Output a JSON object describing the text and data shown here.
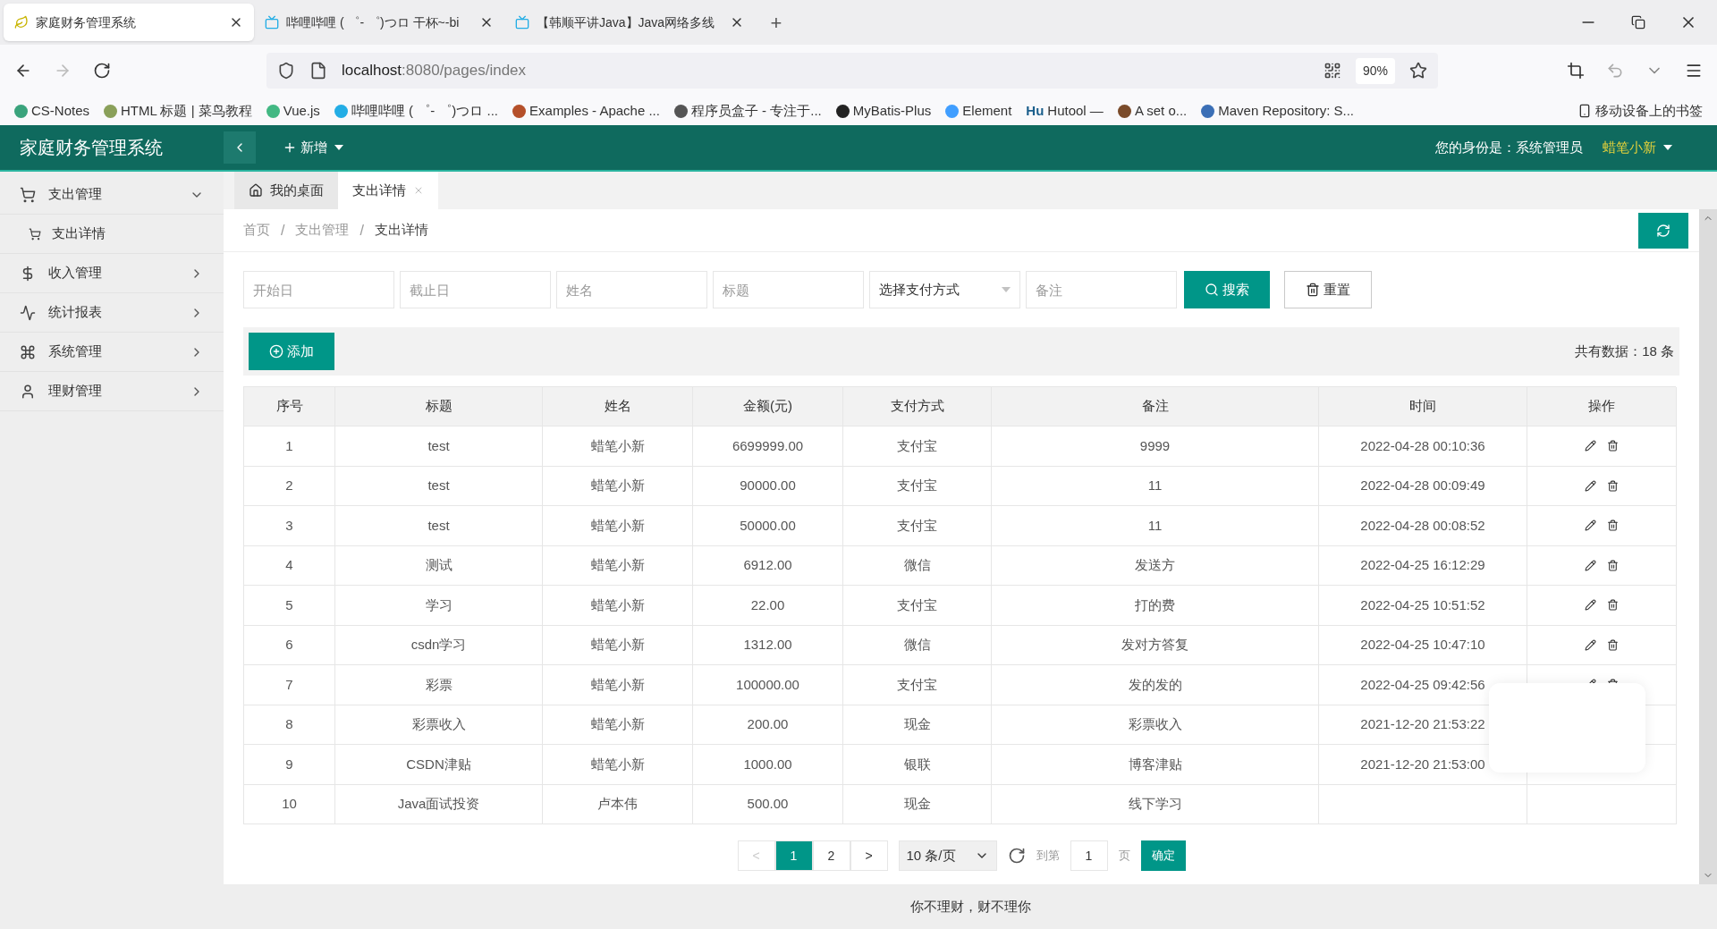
{
  "browser": {
    "tabs": [
      {
        "title": "家庭财务管理系统",
        "selected": true
      },
      {
        "title": "哔哩哔哩 ( ゜- ゜)つロ 干杯~-bi",
        "selected": false
      },
      {
        "title": "【韩顺平讲Java】Java网络多线",
        "selected": false
      }
    ],
    "new_tab": "+",
    "address": {
      "host": "localhost",
      "path": ":8080/pages/index"
    },
    "zoom": "90%",
    "bookmarks": [
      {
        "label": "CS-Notes",
        "color": "#3aa37c"
      },
      {
        "label": "HTML 标题 | 菜鸟教程",
        "color": "#8aa05a"
      },
      {
        "label": "Vue.js",
        "color": "#42b883"
      },
      {
        "label": "哔哩哔哩 ( ゜- ゜)つロ ...",
        "color": "#23ade5"
      },
      {
        "label": "Examples - Apache ...",
        "color": "#b5502a"
      },
      {
        "label": "程序员盒子 - 专注于...",
        "color": "#555555"
      },
      {
        "label": "MyBatis-Plus",
        "color": "#222222"
      },
      {
        "label": "Element",
        "color": "#409eff"
      },
      {
        "label": "Hutool —",
        "color": "#1b5f8c",
        "icon_text": "Hu"
      },
      {
        "label": "A set o...",
        "color": "#7a4b2a"
      },
      {
        "label": "Maven Repository: S...",
        "color": "#3b6fb6"
      }
    ],
    "mobile_bookmarks": "移动设备上的书签"
  },
  "app": {
    "title": "家庭财务管理系统",
    "new_menu": "新增",
    "role": "您的身份是：系统管理员",
    "user": "蜡笔小新"
  },
  "sidebar": {
    "items": [
      {
        "label": "支出管理",
        "expanded": true,
        "children": [
          {
            "label": "支出详情"
          }
        ]
      },
      {
        "label": "收入管理",
        "expanded": false
      },
      {
        "label": "统计报表",
        "expanded": false
      },
      {
        "label": "系统管理",
        "expanded": false
      },
      {
        "label": "理财管理",
        "expanded": false
      }
    ]
  },
  "page_tabs": [
    {
      "label": "我的桌面",
      "selected": false,
      "closable": false
    },
    {
      "label": "支出详情",
      "selected": true,
      "closable": true
    }
  ],
  "breadcrumb": [
    "首页",
    "支出管理",
    "支出详情"
  ],
  "breadcrumb_separator": "/",
  "filters": [
    {
      "kind": "input",
      "placeholder": "开始日"
    },
    {
      "kind": "input",
      "placeholder": "截止日"
    },
    {
      "kind": "input",
      "placeholder": "姓名"
    },
    {
      "kind": "input",
      "placeholder": "标题"
    },
    {
      "kind": "select",
      "value": "选择支付方式"
    },
    {
      "kind": "input",
      "placeholder": "备注"
    }
  ],
  "search_button": "搜索",
  "reset_button": "重置",
  "add_button": "添加",
  "total": "共有数据：18 条",
  "table": {
    "columns": [
      "序号",
      "标题",
      "姓名",
      "金额(元)",
      "支付方式",
      "备注",
      "时间",
      "操作"
    ],
    "rows": [
      {
        "cells": [
          "1",
          "test",
          "蜡笔小新",
          "6699999.00",
          "支付宝",
          "9999",
          "2022-04-28 00:10:36"
        ],
        "actions": true
      },
      {
        "cells": [
          "2",
          "test",
          "蜡笔小新",
          "90000.00",
          "支付宝",
          "11",
          "2022-04-28 00:09:49"
        ],
        "actions": true
      },
      {
        "cells": [
          "3",
          "test",
          "蜡笔小新",
          "50000.00",
          "支付宝",
          "11",
          "2022-04-28 00:08:52"
        ],
        "actions": true
      },
      {
        "cells": [
          "4",
          "测试",
          "蜡笔小新",
          "6912.00",
          "微信",
          "发送方",
          "2022-04-25 16:12:29"
        ],
        "actions": true
      },
      {
        "cells": [
          "5",
          "学习",
          "蜡笔小新",
          "22.00",
          "支付宝",
          "打的费",
          "2022-04-25 10:51:52"
        ],
        "actions": true
      },
      {
        "cells": [
          "6",
          "csdn学习",
          "蜡笔小新",
          "1312.00",
          "微信",
          "发对方答复",
          "2022-04-25 10:47:10"
        ],
        "actions": true
      },
      {
        "cells": [
          "7",
          "彩票",
          "蜡笔小新",
          "100000.00",
          "支付宝",
          "发的发的",
          "2022-04-25 09:42:56"
        ],
        "actions": true
      },
      {
        "cells": [
          "8",
          "彩票收入",
          "蜡笔小新",
          "200.00",
          "现金",
          "彩票收入",
          "2021-12-20 21:53:22"
        ]
      },
      {
        "cells": [
          "9",
          "CSDN津贴",
          "蜡笔小新",
          "1000.00",
          "银联",
          "博客津贴",
          "2021-12-20 21:53:00"
        ]
      },
      {
        "cells": [
          "10",
          "Java面试投资",
          "卢本伟",
          "500.00",
          "现金",
          "线下学习"
        ],
        "actions": false
      }
    ]
  },
  "pagination": {
    "prev": "<",
    "pages": [
      {
        "label": "1",
        "selected": true
      },
      {
        "label": "2",
        "selected": false
      }
    ],
    "next": ">",
    "page_size": "10 条/页",
    "goto_label": "到第",
    "goto_value": "1",
    "page_unit": "页",
    "confirm": "确定"
  },
  "footer": "你不理财，财不理你"
}
